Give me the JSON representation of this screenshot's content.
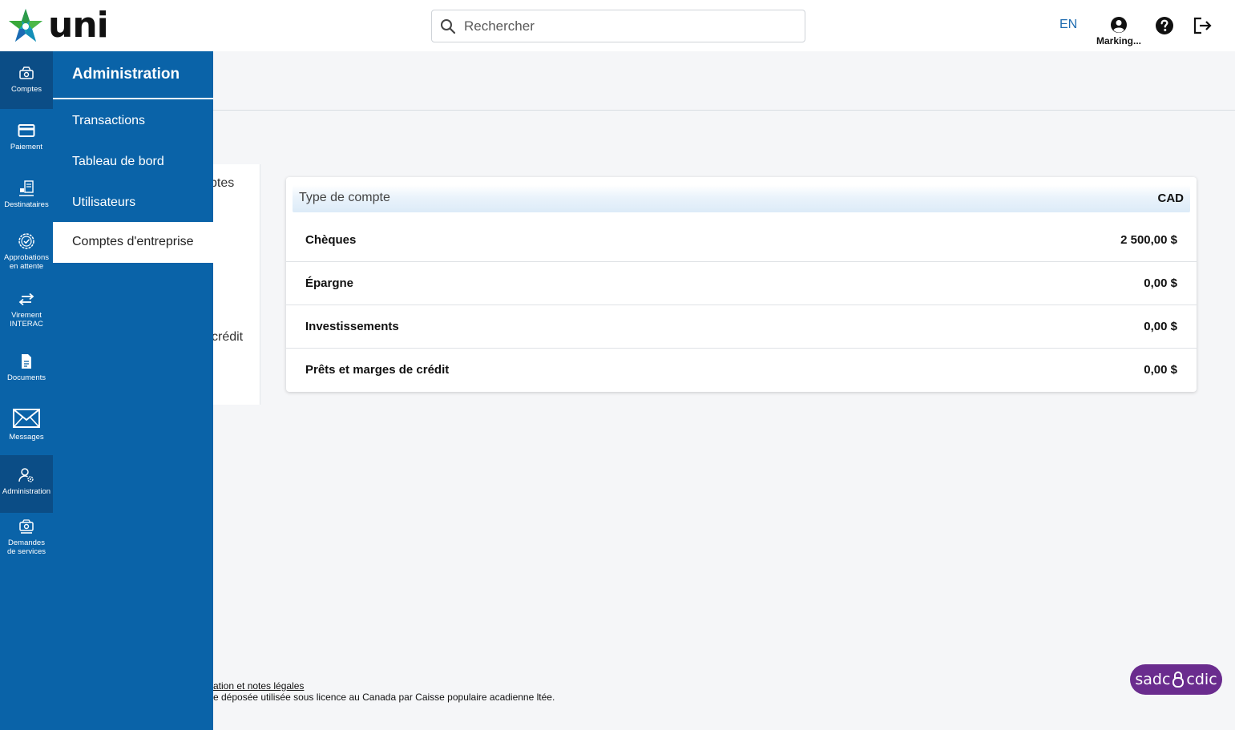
{
  "header": {
    "brand": "uni",
    "search_placeholder": "Rechercher",
    "lang": "EN",
    "user_name": "Marking..."
  },
  "rail": {
    "items": [
      {
        "label": "Comptes",
        "icon": "accounts-icon"
      },
      {
        "label": "Paiement",
        "icon": "card-icon"
      },
      {
        "label": "Destinataires",
        "icon": "payees-icon"
      },
      {
        "label": "Approbations\nen attente",
        "icon": "approval-badge-icon"
      },
      {
        "label": "Virement\nINTERAC",
        "icon": "transfer-arrows-icon"
      },
      {
        "label": "Documents",
        "icon": "document-icon"
      },
      {
        "label": "Messages",
        "icon": "envelope-icon"
      },
      {
        "label": "Administration",
        "icon": "admin-user-gear-icon"
      },
      {
        "label": "Demandes\nde services",
        "icon": "service-request-icon"
      }
    ]
  },
  "flyout": {
    "title": "Administration",
    "items": [
      {
        "label": "Transactions"
      },
      {
        "label": "Tableau de bord"
      },
      {
        "label": "Utilisateurs"
      },
      {
        "label": "Comptes d'entreprise"
      }
    ]
  },
  "left_card": {
    "peek_1": "ptes",
    "peek_2": "crédit"
  },
  "accounts": {
    "header_type": "Type de compte",
    "header_currency": "CAD",
    "rows": [
      {
        "name": "Chèques",
        "amount": "2 500,00 $"
      },
      {
        "name": "Épargne",
        "amount": "0,00 $"
      },
      {
        "name": "Investissements",
        "amount": "0,00 $"
      },
      {
        "name": "Prêts et marges de crédit",
        "amount": "0,00 $"
      }
    ]
  },
  "footer": {
    "link": "ation et notes légales",
    "text": "e déposée utilisée sous licence au Canada par Caisse populaire acadienne ltée.",
    "cdic_left": "sadc",
    "cdic_right": "cdic"
  },
  "colors": {
    "primary": "#0a63a8",
    "primary_dark": "#0b4d86",
    "cdic": "#6a2c8e",
    "link": "#1e6bb0"
  }
}
